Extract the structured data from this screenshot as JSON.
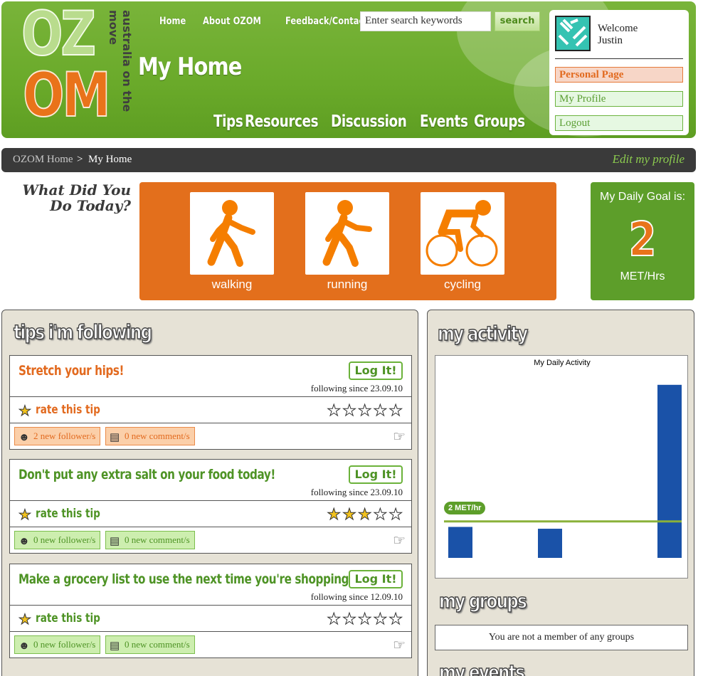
{
  "logo": {
    "top": "OZ",
    "bottom": "OM",
    "tagline": "australia on the move"
  },
  "topnav": [
    "Home",
    "About OZOM",
    "Feedback/Contact"
  ],
  "search": {
    "placeholder": "Enter search keywords",
    "button": "search"
  },
  "page_title": "My Home",
  "mainnav": [
    "Tips",
    "Resources",
    "Discussion",
    "Events",
    "Groups"
  ],
  "user": {
    "welcome": "Welcome",
    "name": "Justin",
    "links": [
      "Personal Page",
      "My Profile",
      "Logout"
    ]
  },
  "breadcrumb": {
    "home": "OZOM Home",
    "sep": ">",
    "current": "My Home",
    "edit": "Edit my profile"
  },
  "what_did_you_do": {
    "line1": "What Did You",
    "line2": "Do Today?"
  },
  "activities": [
    {
      "label": "walking",
      "icon": "walking-icon"
    },
    {
      "label": "running",
      "icon": "running-icon"
    },
    {
      "label": "cycling",
      "icon": "cycling-icon"
    }
  ],
  "daily_goal": {
    "title": "My Daily Goal is:",
    "value": "2",
    "unit": "MET/Hrs"
  },
  "tips_panel": {
    "title": "tips i'm following"
  },
  "tips": [
    {
      "title": "Stretch your hips!",
      "title_color": "#e26a1f",
      "log": "Log It!",
      "since": "following since 23.09.10",
      "rate": "rate this tip",
      "rating": 0,
      "followers": "2 new follower/s",
      "comments": "0 new comment/s",
      "chip_style": "orange"
    },
    {
      "title": "Don't put any extra salt on your food today!",
      "title_color": "#4e9325",
      "log": "Log It!",
      "since": "following since 23.09.10",
      "rate": "rate this tip",
      "rating": 3,
      "followers": "0 new follower/s",
      "comments": "0 new comment/s",
      "chip_style": "green"
    },
    {
      "title": "Make a grocery list to use the next time you're shopping",
      "title_color": "#4e9325",
      "log": "Log It!",
      "since": "following since 12.09.10",
      "rate": "rate this tip",
      "rating": 0,
      "followers": "0 new follower/s",
      "comments": "0 new comment/s",
      "chip_style": "green"
    }
  ],
  "activity_panel": {
    "title": "my activity"
  },
  "groups_panel": {
    "title": "my groups",
    "empty": "You are not a member of any groups"
  },
  "events_panel": {
    "title": "my events"
  },
  "chart_data": {
    "type": "bar",
    "title": "My Daily Activity",
    "categories": [
      "",
      "",
      ""
    ],
    "values": [
      1.7,
      1.6,
      9.5
    ],
    "goal": 2,
    "goal_label": "2 MET/hr",
    "ylim": [
      0,
      10
    ],
    "bar_color": "#1a52a8",
    "goal_color": "#8ab13a"
  },
  "colors": {
    "green": "#6aaa2a",
    "orange": "#e36f1c",
    "dark": "#3a3a3a"
  }
}
